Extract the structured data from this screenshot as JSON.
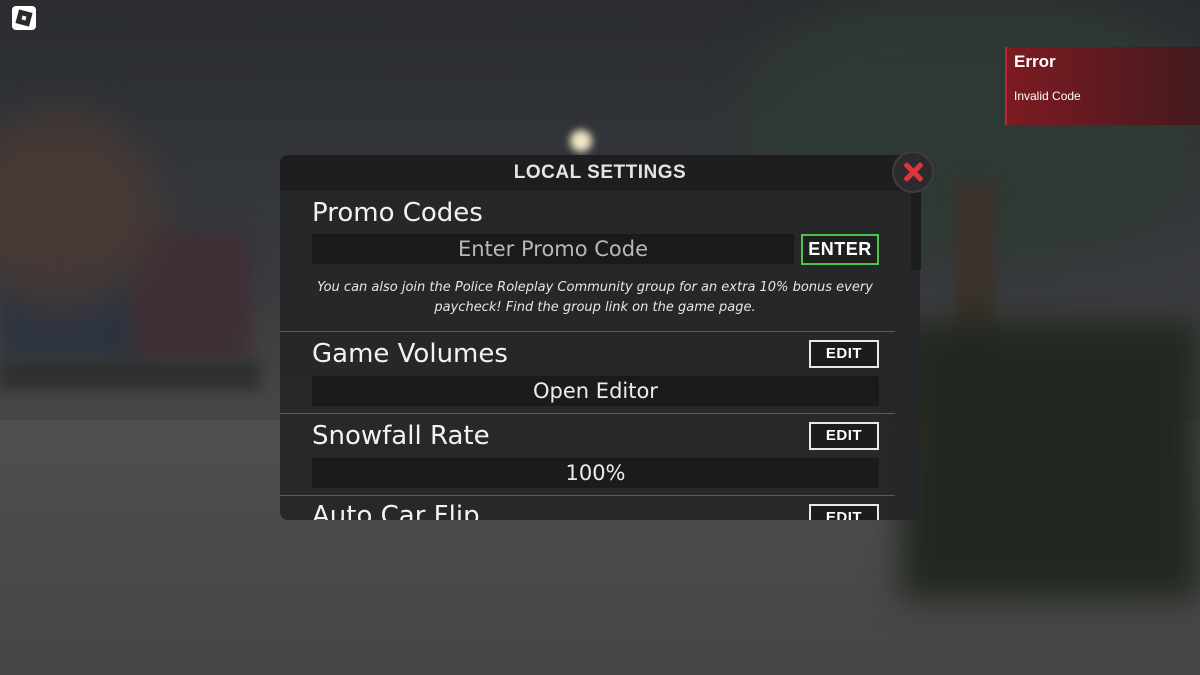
{
  "toast": {
    "title": "Error",
    "message": "Invalid Code"
  },
  "panel": {
    "title": "LOCAL SETTINGS",
    "promo": {
      "heading": "Promo Codes",
      "placeholder": "Enter Promo Code",
      "enter_label": "ENTER",
      "note": "You can also join the Police Roleplay Community group for an extra 10% bonus every paycheck! Find the group link on the game page."
    },
    "settings": [
      {
        "heading": "Game Volumes",
        "edit_label": "EDIT",
        "value": "Open Editor"
      },
      {
        "heading": "Snowfall Rate",
        "edit_label": "EDIT",
        "value": "100%"
      },
      {
        "heading": "Auto Car Flip",
        "edit_label": "EDIT",
        "value": ""
      }
    ]
  },
  "icons": {
    "app": "roblox-logo-icon",
    "close": "close-icon"
  },
  "colors": {
    "accent_green": "#4cc44a",
    "close_red": "#e0333b",
    "toast_red": "#7e1a22"
  }
}
